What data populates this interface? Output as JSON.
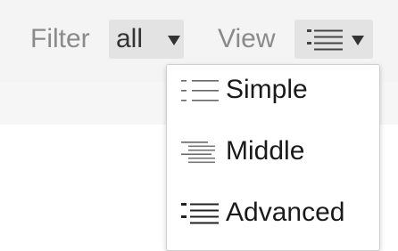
{
  "toolbar": {
    "filter_label": "Filter",
    "filter_value": "all",
    "view_label": "View"
  },
  "view_menu": {
    "items": [
      {
        "label": "Simple",
        "icon": "list-simple-icon"
      },
      {
        "label": "Middle",
        "icon": "list-middle-icon"
      },
      {
        "label": "Advanced",
        "icon": "list-advanced-icon"
      }
    ]
  }
}
